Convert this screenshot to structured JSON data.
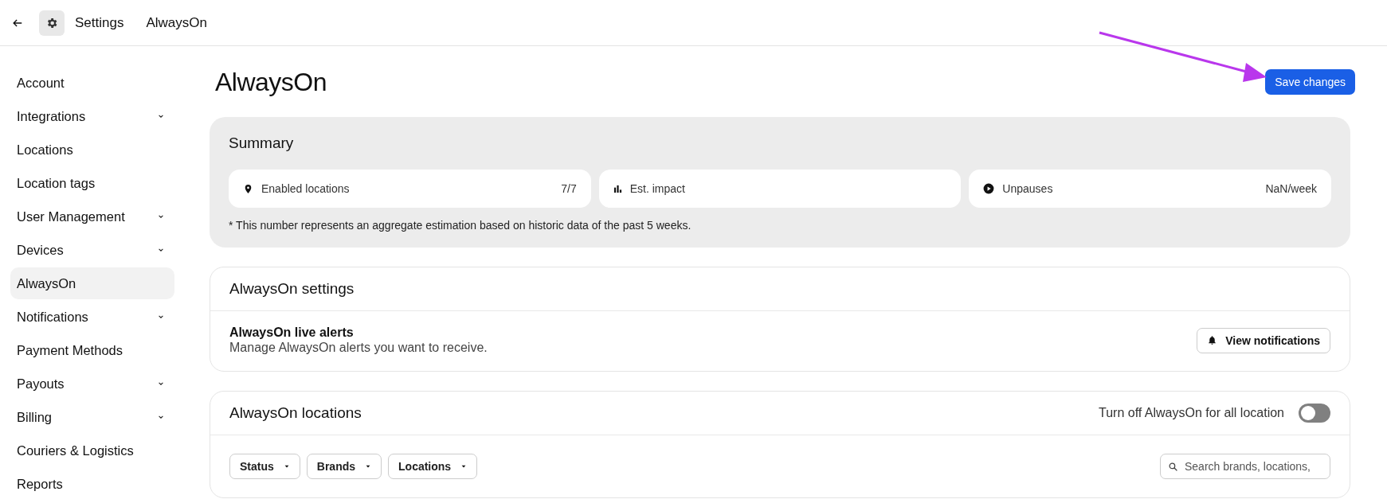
{
  "header": {
    "title": "Settings",
    "breadcrumb": "AlwaysOn"
  },
  "sidebar": {
    "items": [
      {
        "label": "Account",
        "expandable": false,
        "selected": false
      },
      {
        "label": "Integrations",
        "expandable": true,
        "selected": false
      },
      {
        "label": "Locations",
        "expandable": false,
        "selected": false
      },
      {
        "label": "Location tags",
        "expandable": false,
        "selected": false
      },
      {
        "label": "User Management",
        "expandable": true,
        "selected": false
      },
      {
        "label": "Devices",
        "expandable": true,
        "selected": false
      },
      {
        "label": "AlwaysOn",
        "expandable": false,
        "selected": true
      },
      {
        "label": "Notifications",
        "expandable": true,
        "selected": false
      },
      {
        "label": "Payment Methods",
        "expandable": false,
        "selected": false
      },
      {
        "label": "Payouts",
        "expandable": true,
        "selected": false
      },
      {
        "label": "Billing",
        "expandable": true,
        "selected": false
      },
      {
        "label": "Couriers & Logistics",
        "expandable": false,
        "selected": false
      },
      {
        "label": "Reports",
        "expandable": false,
        "selected": false
      }
    ]
  },
  "page": {
    "title": "AlwaysOn",
    "save_button": "Save changes"
  },
  "summary": {
    "title": "Summary",
    "stats": [
      {
        "label": "Enabled locations",
        "value": "7/7"
      },
      {
        "label": "Est. impact"
      },
      {
        "label": "Unpauses",
        "value": "NaN/week"
      }
    ],
    "footnote": "* This number represents an aggregate estimation based on historic data of the past 5 weeks."
  },
  "settings": {
    "title": "AlwaysOn settings",
    "alerts_title": "AlwaysOn live alerts",
    "alerts_description": "Manage AlwaysOn alerts you want to receive.",
    "button": "View notifications"
  },
  "locations": {
    "title": "AlwaysOn locations",
    "toggle_label": "Turn off AlwaysOn for all location",
    "toggle_on": false,
    "filters": [
      "Status",
      "Brands",
      "Locations"
    ],
    "search": {
      "placeholder": "Search brands, locations,"
    }
  }
}
